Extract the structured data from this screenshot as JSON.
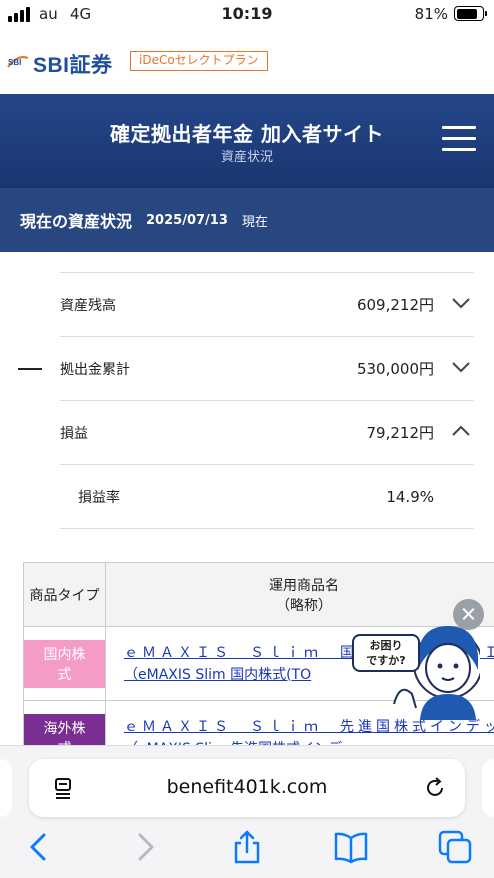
{
  "status_bar": {
    "carrier": "au",
    "network": "4G",
    "time": "10:19",
    "battery_percent": "81%",
    "battery_level": 0.81
  },
  "brand": {
    "logo_text": "SBI証券",
    "logo_mark_text": "SBI",
    "plan_label": "iDeCoセレクトプラン"
  },
  "header": {
    "title": "確定拠出者年金 加入者サイト",
    "subtitle": "資産状況",
    "menu_icon": "hamburger-icon"
  },
  "asset_section": {
    "heading": "現在の資産状況",
    "date": "2025/07/13",
    "as_of": "現在"
  },
  "summary": {
    "rows": [
      {
        "label": "資産残高",
        "value": "609,212円",
        "icon": "chevron-down-icon"
      },
      {
        "label": "拠出金累計",
        "value": "530,000円",
        "icon": "chevron-down-icon"
      },
      {
        "label": "損益",
        "value": "79,212円",
        "icon": "chevron-up-icon"
      },
      {
        "label": "損益率",
        "value": "14.9%"
      }
    ]
  },
  "products": {
    "headers": {
      "type": "商品タイプ",
      "name_line1": "運用商品名",
      "name_line2": "（略称）"
    },
    "rows": [
      {
        "type": "国内株式",
        "name_line1": "ｅＭＡＸＩＳ　Ｓｌｉｍ　国内株式（ＴＯＰＩ",
        "name_line2": "（eMAXIS Slim 国内株式(TO",
        "tag_color": "#f59bc8"
      },
      {
        "type": "海外株式",
        "name_line1": "ｅＭＡＸＩＳ　Ｓｌｉｍ　先進国株式インデッ",
        "name_line2": "（eMAXIS Slim 先進国株式インデ",
        "tag_color": "#7a2e91"
      }
    ]
  },
  "help": {
    "bubble_line1": "お困り",
    "bubble_line2": "ですか?"
  },
  "browser": {
    "url": "benefit401k.com",
    "toolbar": [
      "back-icon",
      "forward-icon",
      "share-icon",
      "bookmarks-icon",
      "tabs-icon"
    ]
  },
  "colors": {
    "brand_blue": "#1e4fa3",
    "header_band": "#24478a",
    "plan_orange": "#e8742a",
    "link_blue": "#1a37b8",
    "ios_blue": "#0a7aff"
  }
}
